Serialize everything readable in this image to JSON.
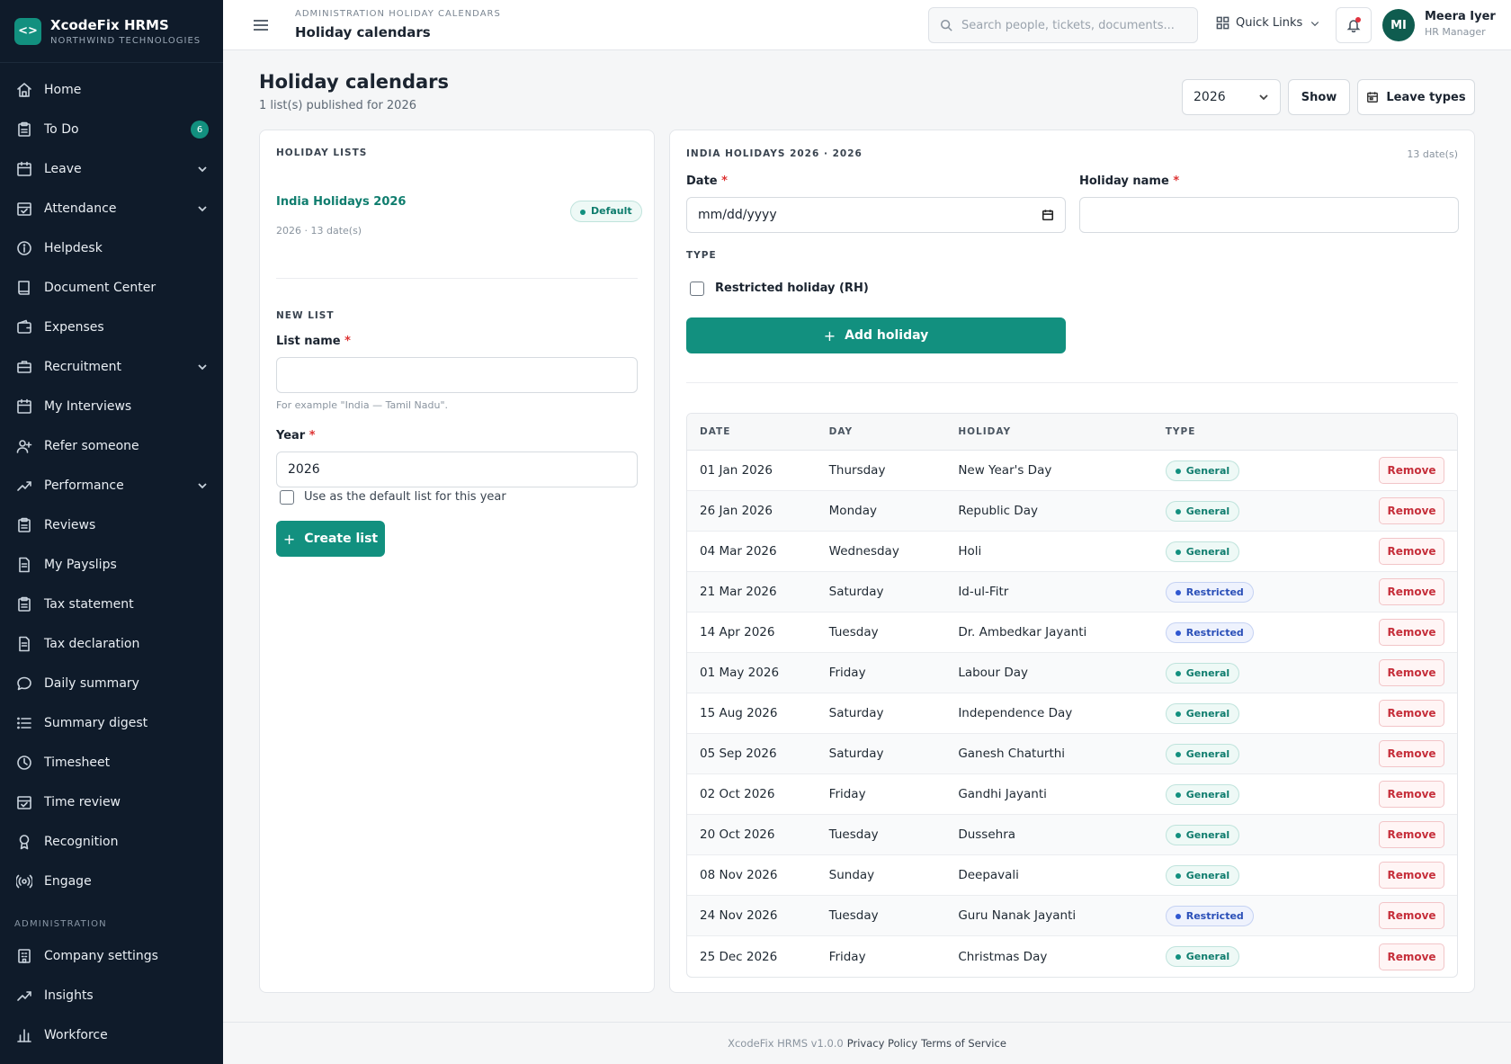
{
  "brand": {
    "name": "XcodeFix HRMS",
    "org": "NORTHWIND TECHNOLOGIES",
    "logo": "<>"
  },
  "sidebar": {
    "items": [
      {
        "label": "Home",
        "icon": "home-icon"
      },
      {
        "label": "To Do",
        "icon": "clipboard-icon",
        "badge": "6"
      },
      {
        "label": "Leave",
        "icon": "calendar-icon",
        "chevron": true
      },
      {
        "label": "Attendance",
        "icon": "calendar-check-icon",
        "chevron": true
      },
      {
        "label": "Helpdesk",
        "icon": "info-icon"
      },
      {
        "label": "Document Center",
        "icon": "book-icon"
      },
      {
        "label": "Expenses",
        "icon": "wallet-icon"
      },
      {
        "label": "Recruitment",
        "icon": "briefcase-icon",
        "chevron": true
      },
      {
        "label": "My Interviews",
        "icon": "calendar-icon"
      },
      {
        "label": "Refer someone",
        "icon": "user-plus-icon"
      },
      {
        "label": "Performance",
        "icon": "trending-up-icon",
        "chevron": true
      },
      {
        "label": "Reviews",
        "icon": "clipboard-icon"
      },
      {
        "label": "My Payslips",
        "icon": "file-icon"
      },
      {
        "label": "Tax statement",
        "icon": "clipboard-icon"
      },
      {
        "label": "Tax declaration",
        "icon": "file-icon"
      },
      {
        "label": "Daily summary",
        "icon": "message-icon"
      },
      {
        "label": "Summary digest",
        "icon": "list-icon"
      },
      {
        "label": "Timesheet",
        "icon": "clock-icon"
      },
      {
        "label": "Time review",
        "icon": "calendar-check-icon"
      },
      {
        "label": "Recognition",
        "icon": "award-icon"
      },
      {
        "label": "Engage",
        "icon": "broadcast-icon"
      }
    ],
    "admin_section": "ADMINISTRATION",
    "admin_items": [
      {
        "label": "Company settings",
        "icon": "building-icon"
      },
      {
        "label": "Insights",
        "icon": "trending-up-icon"
      },
      {
        "label": "Workforce",
        "icon": "bar-chart-icon"
      }
    ]
  },
  "topbar": {
    "breadcrumb": "ADMINISTRATION HOLIDAY CALENDARS",
    "title": "Holiday calendars",
    "search_placeholder": "Search people, tickets, documents...",
    "quick_links": "Quick Links",
    "user_initials": "MI",
    "user_name": "Meera Iyer",
    "user_role": "HR Manager"
  },
  "page": {
    "title": "Holiday calendars",
    "subtitle": "1 list(s) published for 2026",
    "year_select": "2026",
    "show_label": "Show",
    "leave_types_label": "Leave types"
  },
  "lists_panel": {
    "heading": "HOLIDAY LISTS",
    "list_name": "India Holidays 2026",
    "list_meta": "2026 · 13 date(s)",
    "default_badge": "Default",
    "new_list_heading": "NEW LIST",
    "list_name_label": "List name",
    "list_name_value": "",
    "list_name_hint": "For example \"India — Tamil Nadu\".",
    "year_label": "Year",
    "year_value": "2026",
    "default_checkbox_label": "Use as the default list for this year",
    "create_label": "Create list",
    "required_mark": "*"
  },
  "holiday_panel": {
    "heading": "INDIA HOLIDAYS 2026 · 2026",
    "count": "13 date(s)",
    "date_label": "Date",
    "date_placeholder": "mm/dd/yyyy",
    "holiday_name_label": "Holiday name",
    "holiday_name_value": "",
    "type_heading": "TYPE",
    "restricted_label": "Restricted holiday (RH)",
    "add_label": "Add holiday",
    "columns": [
      "DATE",
      "DAY",
      "HOLIDAY",
      "TYPE"
    ],
    "remove_label": "Remove",
    "rows": [
      {
        "date": "01 Jan 2026",
        "day": "Thursday",
        "holiday": "New Year's Day",
        "type": "General"
      },
      {
        "date": "26 Jan 2026",
        "day": "Monday",
        "holiday": "Republic Day",
        "type": "General"
      },
      {
        "date": "04 Mar 2026",
        "day": "Wednesday",
        "holiday": "Holi",
        "type": "General"
      },
      {
        "date": "21 Mar 2026",
        "day": "Saturday",
        "holiday": "Id-ul-Fitr",
        "type": "Restricted"
      },
      {
        "date": "14 Apr 2026",
        "day": "Tuesday",
        "holiday": "Dr. Ambedkar Jayanti",
        "type": "Restricted"
      },
      {
        "date": "01 May 2026",
        "day": "Friday",
        "holiday": "Labour Day",
        "type": "General"
      },
      {
        "date": "15 Aug 2026",
        "day": "Saturday",
        "holiday": "Independence Day",
        "type": "General"
      },
      {
        "date": "05 Sep 2026",
        "day": "Saturday",
        "holiday": "Ganesh Chaturthi",
        "type": "General"
      },
      {
        "date": "02 Oct 2026",
        "day": "Friday",
        "holiday": "Gandhi Jayanti",
        "type": "General"
      },
      {
        "date": "20 Oct 2026",
        "day": "Tuesday",
        "holiday": "Dussehra",
        "type": "General"
      },
      {
        "date": "08 Nov 2026",
        "day": "Sunday",
        "holiday": "Deepavali",
        "type": "General"
      },
      {
        "date": "24 Nov 2026",
        "day": "Tuesday",
        "holiday": "Guru Nanak Jayanti",
        "type": "Restricted"
      },
      {
        "date": "25 Dec 2026",
        "day": "Friday",
        "holiday": "Christmas Day",
        "type": "General"
      }
    ]
  },
  "footer": {
    "version": "XcodeFix HRMS v1.0.0",
    "privacy": "Privacy Policy",
    "terms": "Terms of Service"
  },
  "colors": {
    "accent": "#12907f",
    "sidebar": "#0f1b2a",
    "danger": "#c62f3b",
    "restricted": "#2a4fb8"
  }
}
